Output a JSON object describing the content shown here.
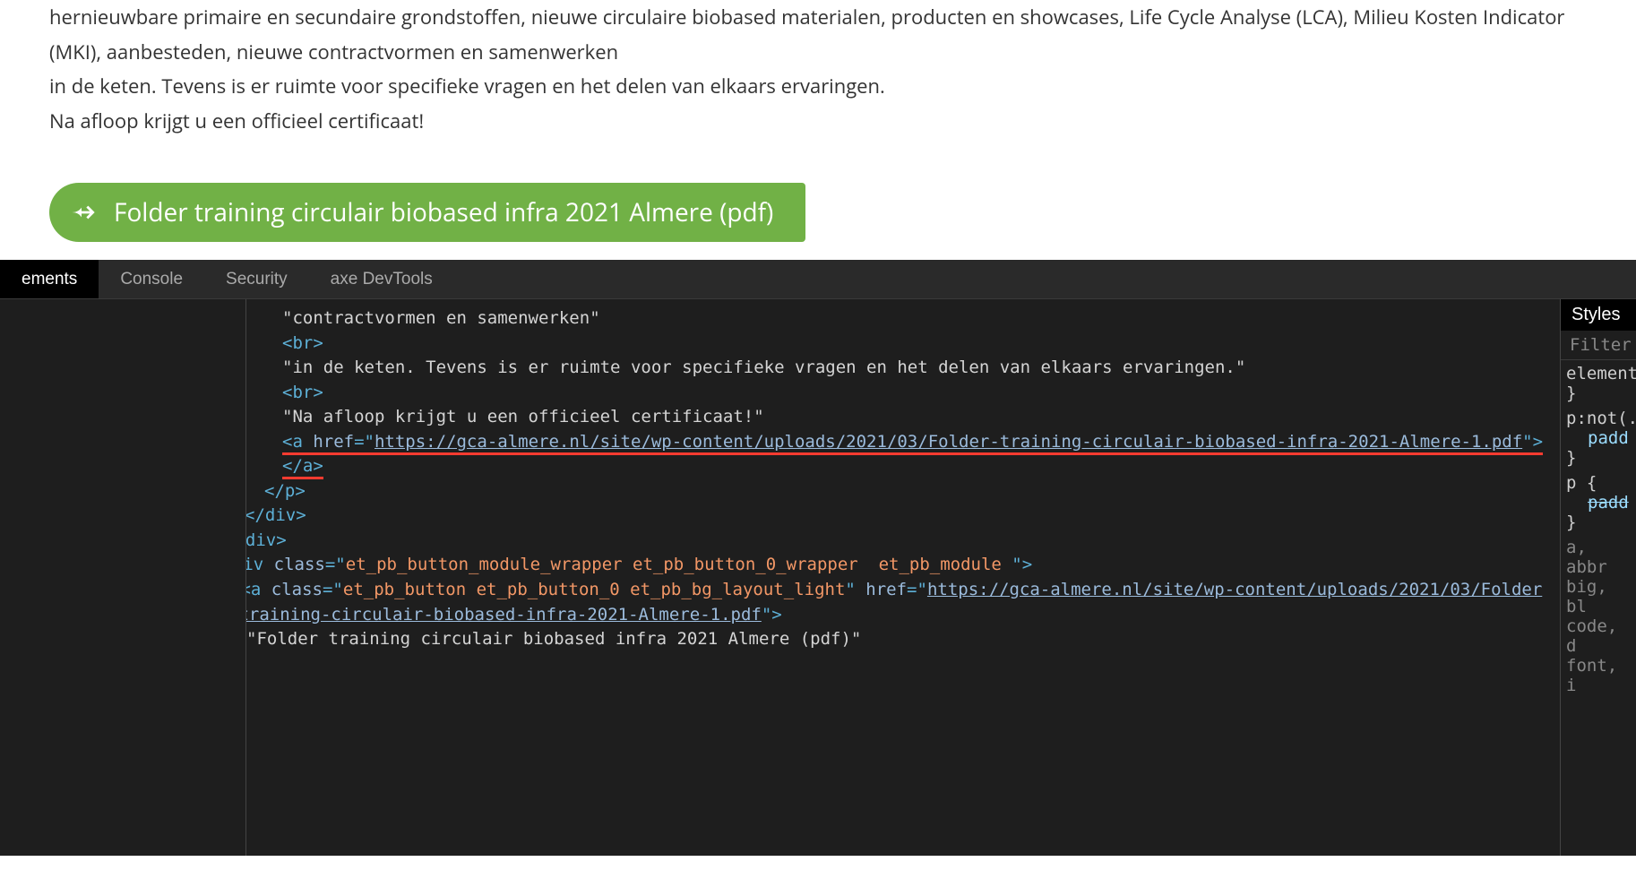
{
  "page": {
    "paragraph1": "hernieuwbare primaire en secundaire grondstoffen, nieuwe circulaire biobased materialen, producten en showcases, Life Cycle Analyse (LCA), Milieu Kosten Indicator (MKI), aanbesteden, nieuwe contractvormen en samenwerken",
    "paragraph2": "in de keten. Tevens is er ruimte voor specifieke vragen en het delen van elkaars ervaringen.",
    "paragraph3": "Na afloop krijgt u een officieel certificaat!",
    "button_label": "Folder training circulair biobased infra 2021 Almere (pdf)"
  },
  "devtools": {
    "tabs": {
      "elements": "ements",
      "console": "Console",
      "security": "Security",
      "axe": "axe DevTools"
    },
    "elements": {
      "text1": "contractvormen en samenwerken",
      "br": "<br>",
      "text2": "in de keten. Tevens is er ruimte voor specifieke vragen en het delen van elkaars ervaringen.",
      "text3": "Na afloop krijgt u een officieel certificaat!",
      "anchor_open": "<a ",
      "href_name": "href",
      "href_eq": "=\"",
      "url": "https://gca-almere.nl/site/wp-content/uploads/2021/03/Folder-training-circulair-biobased-infra-2021-Almere-1.pdf",
      "quote_close": "\"",
      "anchor_close": "></a>",
      "close_p": "</p>",
      "close_div1": "</div>",
      "close_div2": "</div>",
      "wrapper_open": "<div ",
      "wrapper_class_name": "class",
      "wrapper_class_val": "et_pb_button_module_wrapper et_pb_button_0_wrapper  et_pb_module ",
      "wrapper_close": ">",
      "btn_anchor_open": "<a ",
      "btn_class_val": "et_pb_button et_pb_button_0 et_pb_bg_layout_light",
      "btn_href_url": "https://gca-almere.nl/site/wp-content/uploads/2021/03/Folder-training-circulair-biobased-infra-2021-Almere-1.pdf",
      "btn_close": ">",
      "btn_text": "Folder training circulair biobased infra 2021 Almere (pdf)"
    },
    "styles": {
      "tab": "Styles",
      "filter": "Filter",
      "rule1_sel": "element",
      "rule1_brace": "}",
      "rule2_sel": "p:not(.",
      "rule2_prop": "padd",
      "rule2_brace": "}",
      "rule3_sel": "p {",
      "rule3_prop": "padd",
      "rule3_brace": "}",
      "rule4": "a, abbr",
      "rule5": "big, bl",
      "rule6": "code, d",
      "rule7": "font, i"
    }
  }
}
